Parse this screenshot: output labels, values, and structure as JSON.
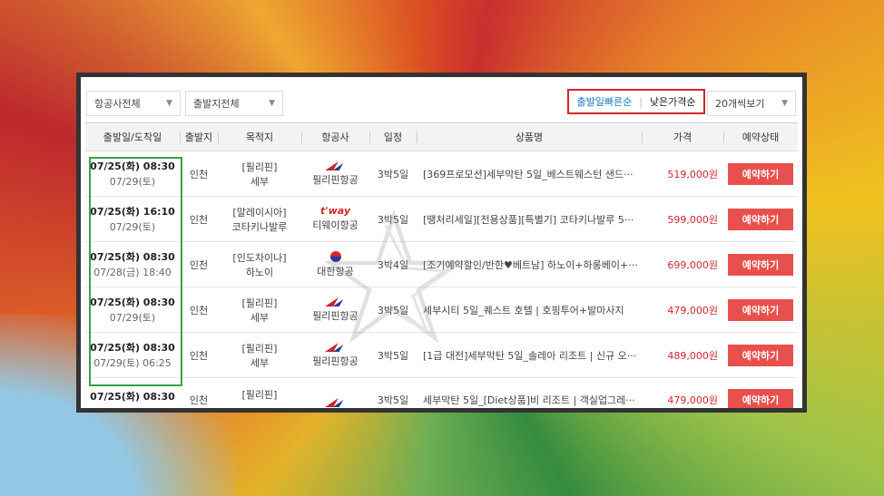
{
  "filters": {
    "airline": "항공사전체",
    "departure": "출발지전체",
    "page_size": "20개씩보기"
  },
  "sort": {
    "option_active": "출발일빠른순",
    "separator": "|",
    "option_inactive": "낮은가격순"
  },
  "columns": [
    "출발일/도착일",
    "출발지",
    "목적지",
    "항공사",
    "일정",
    "상품명",
    "가격",
    "예약상태"
  ],
  "rows": [
    {
      "date1": "07/25(화) 08:30",
      "date2": "07/29(토)",
      "origin": "인천",
      "dest1": "[필리핀]",
      "dest2": "세부",
      "logo": "philippine-airlines-logo",
      "airline": "필리핀항공",
      "schedule": "3박5일",
      "product": "[369프로모션]세부막탄 5일_베스트웨스턴 샌드···",
      "price": "519,000원",
      "action": "예약하기"
    },
    {
      "date1": "07/25(화) 16:10",
      "date2": "07/29(토)",
      "origin": "인천",
      "dest1": "[말레이시아]",
      "dest2": "코타키나발루",
      "logo": "tway-logo",
      "logo_text": "t'way",
      "airline": "티웨이항공",
      "schedule": "3박5일",
      "product": "[땡처리세일][전용상품][특별기] 코타키나발루 5···",
      "price": "599,000원",
      "action": "예약하기"
    },
    {
      "date1": "07/25(화) 08:30",
      "date2": "07/28(금) 18:40",
      "origin": "인천",
      "dest1": "[인도차이나]",
      "dest2": "하노이",
      "logo": "korean-air-logo",
      "airline": "대한항공",
      "schedule": "3박4일",
      "product": "[조기예약할인/반한♥베트남] 하노이+하롱베이+···",
      "price": "699,000원",
      "action": "예약하기"
    },
    {
      "date1": "07/25(화) 08:30",
      "date2": "07/29(토)",
      "origin": "인천",
      "dest1": "[필리핀]",
      "dest2": "세부",
      "logo": "philippine-airlines-logo",
      "airline": "필리핀항공",
      "schedule": "3박5일",
      "product": "세부시티 5일_퀘스트 호텔 | 호핑투어+발마사지",
      "price": "479,000원",
      "action": "예약하기"
    },
    {
      "date1": "07/25(화) 08:30",
      "date2": "07/29(토) 06:25",
      "origin": "인천",
      "dest1": "[필리핀]",
      "dest2": "세부",
      "logo": "philippine-airlines-logo",
      "airline": "필리핀항공",
      "schedule": "3박5일",
      "product": "[1급 대전]세부막탄 5일_솔레아 리조트 | 신규 오···",
      "price": "489,000원",
      "action": "예약하기"
    },
    {
      "date1": "07/25(화) 08:30",
      "date2": "",
      "origin": "인천",
      "dest1": "[필리핀]",
      "dest2": "",
      "logo": "philippine-airlines-logo",
      "airline": "",
      "schedule": "3박5일",
      "product": "세부막탄 5일_[Diet상품]비 리조트 | 객실업그레···",
      "price": "479,000원",
      "action": "예약하기"
    }
  ],
  "colors": {
    "accent_red": "#d2262d",
    "button_red": "#e8504d",
    "sort_blue": "#1a78c2",
    "highlight_green": "#3aa047"
  }
}
